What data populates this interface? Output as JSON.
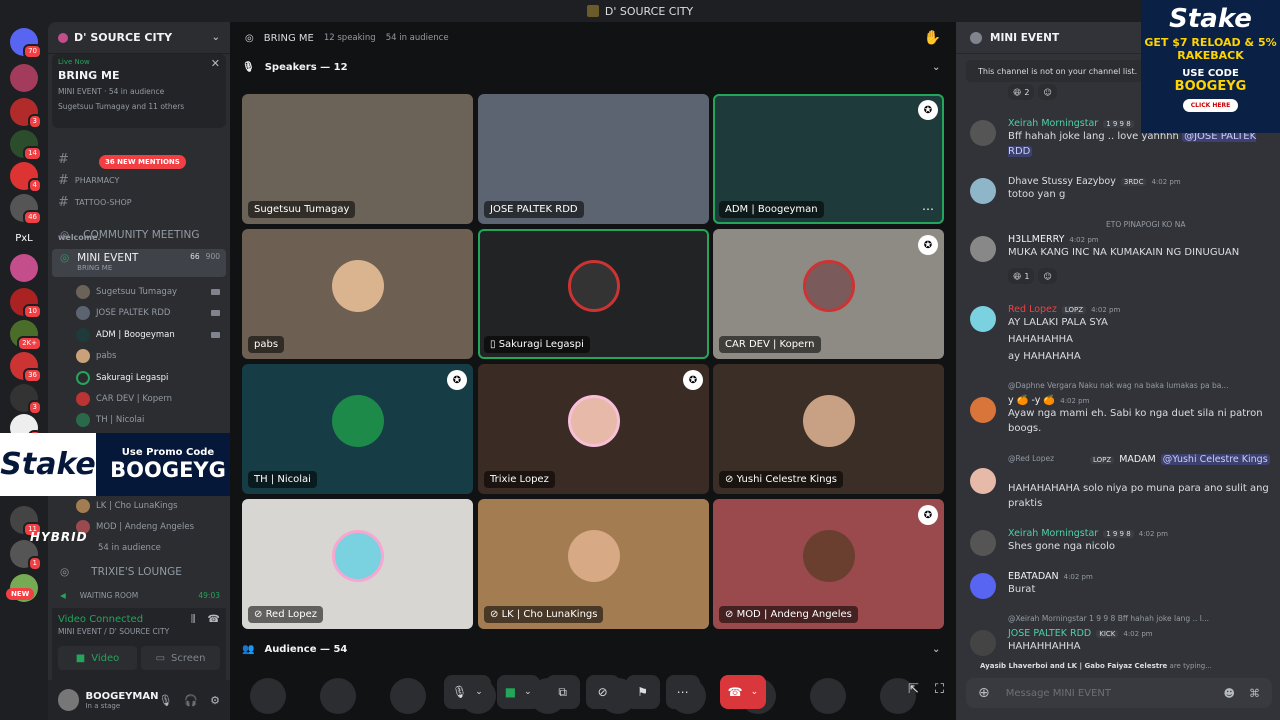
{
  "window": {
    "title": "D' SOURCE CITY"
  },
  "rail": {
    "badges": [
      "70",
      "3",
      "14",
      "4",
      "46",
      "PxL",
      "10",
      "2K+",
      "36",
      "3",
      "3",
      "11",
      "1",
      "NEW"
    ]
  },
  "sidebar": {
    "server_name": "D' SOURCE CITY",
    "live": {
      "tag": "Live Now",
      "title": "BRING ME",
      "sub1": "MINI EVENT · 54 in audience",
      "sub2": "Sugetsuu Tumagay and 11 others"
    },
    "mentions": "36 NEW MENTIONS",
    "text_channels": [
      "PHARMACY",
      "TATTOO-SHOP"
    ],
    "welcome": "welcome.",
    "community": "COMMUNITY MEETING",
    "mini_event": {
      "name": "MINI EVENT",
      "sub": "BRING ME",
      "count": "66",
      "cap": "900"
    },
    "users": [
      "Sugetsuu Tumagay",
      "JOSE PALTEK RDD",
      "ADM | Boogeyman",
      "pabs",
      "Sakuragi Legaspi",
      "CAR DEV | Kopern",
      "TH | Nicolai",
      "LK | Cho LunaKings",
      "MOD | Andeng Angeles"
    ],
    "audience": "54 in audience",
    "trixie": "TRIXIE'S LOUNGE",
    "waiting": "WAITING ROOM",
    "waiting_time": "49:03",
    "voice": {
      "status": "Video Connected",
      "where": "MINI EVENT / D' SOURCE CITY",
      "video": "Video",
      "screen": "Screen"
    },
    "me": {
      "name": "BOOGEYMAN",
      "status": "In a stage"
    }
  },
  "ads": {
    "left_logo": "Stake",
    "left_line1": "Use Promo Code",
    "left_code": "BOOGEYG",
    "hybrid": "HYBRID",
    "right_logo": "Stake",
    "right_offer": "GET $7 RELOAD & 5% RAKEBACK",
    "right_use": "USE CODE",
    "right_code": "BOOGEYG",
    "right_btn": "CLICK HERE"
  },
  "stage": {
    "title": "BRING ME",
    "speaking": "12 speaking",
    "audience": "54 in audience",
    "speakers_label": "Speakers — 12",
    "audience_label": "Audience — 54",
    "tiles": [
      {
        "name": "Sugetsuu Tumagay",
        "bg": "#6b6258"
      },
      {
        "name": "JOSE PALTEK RDD",
        "bg": "#5b6470"
      },
      {
        "name": "ADM | Boogeyman",
        "bg": "#1f3a3a"
      },
      {
        "name": "pabs",
        "bg": "#6e5f53"
      },
      {
        "name": "Sakuragi Legaspi",
        "bg": "#222325"
      },
      {
        "name": "CAR DEV | Kopern",
        "bg": "#8e8a84"
      },
      {
        "name": "TH | Nicolai",
        "bg": "#163c46"
      },
      {
        "name": "Trixie Lopez",
        "bg": "#3a2b24"
      },
      {
        "name": "Yushi Celestre Kings",
        "bg": "#3b2e27"
      },
      {
        "name": "Red Lopez",
        "bg": "#d8d6d2"
      },
      {
        "name": "LK | Cho LunaKings",
        "bg": "#a37c52"
      },
      {
        "name": "MOD | Andeng Angeles",
        "bg": "#9a4a4c"
      }
    ]
  },
  "chat": {
    "channel": "MINI EVENT",
    "notice": "This channel is not on your channel list.",
    "placeholder": "Message MINI EVENT",
    "react1": "2",
    "react2": "1",
    "messages": [
      {
        "user": "Xeirah Morningstar",
        "tag": "1 9 9 8",
        "color": "#4fd1a5",
        "time": "",
        "text": "Bff hahah joke lang .. love yahhhh",
        "mention": "@JOSE PALTEK RDD"
      },
      {
        "user": "Dhave Stussy Eazyboy",
        "tag": "3RDC",
        "color": "#dbdee1",
        "time": "4:02 pm",
        "text": "totoo yan g",
        "mention": ""
      },
      {
        "user": "H3LLMERRY",
        "tag": "",
        "color": "#f2f3f5",
        "time": "4:02 pm",
        "text": "MUKA KANG INC NA KUMAKAIN NG DINUGUAN",
        "mention": ""
      },
      {
        "user": "Red Lopez",
        "tag": "LOPZ",
        "color": "#f23f43",
        "time": "4:02 pm",
        "text": "AY LALAKI PALA SYA",
        "mention": ""
      },
      {
        "user": "",
        "tag": "",
        "color": "",
        "time": "",
        "text": "HAHAHAHHA",
        "mention": ""
      },
      {
        "user": "",
        "tag": "",
        "color": "",
        "time": "",
        "text": "ay HAHAHAHA",
        "mention": ""
      },
      {
        "user": "y 🍊 -y 🍊",
        "tag": "",
        "color": "#f2f3f5",
        "time": "4:02 pm",
        "text": "Ayaw nga mami eh. Sabi ko nga duet sila ni patron boogs.",
        "mention": ""
      },
      {
        "user": "MADAM",
        "tag": "LOPZ",
        "color": "#f2f3f5",
        "time": "",
        "text": "HAHAHAHAHA solo niya po muna para ano sulit ang praktis",
        "mention": "@Yushi Celestre Kings"
      },
      {
        "user": "Xeirah Morningstar",
        "tag": "1 9 9 8",
        "color": "#4fd1a5",
        "time": "4:02 pm",
        "text": "Shes gone nga nicolo",
        "mention": ""
      },
      {
        "user": "EBATADAN",
        "tag": "",
        "color": "#f2f3f5",
        "time": "4:02 pm",
        "text": "Burat",
        "mention": ""
      },
      {
        "user": "JOSE PALTEK RDD",
        "tag": "KICK",
        "color": "#4fd1a5",
        "time": "4:02 pm",
        "text": "HAHAHHAHHA",
        "mention": ""
      }
    ],
    "replies": [
      "ETO PINAPOGI KO NA",
      "@Daphne Vergara  Naku nak wag na baka lumakas pa ba...",
      "@Red Lopez",
      "@Xeirah Morningstar  1 9 9 8  Bff hahah joke lang .. l..."
    ],
    "typing_users": "Ayasib Lhaverboi and LK | Gabo Faiyaz Celestre",
    "typing_suffix": "are typing..."
  },
  "colors": {
    "accent": "#5865f2",
    "green": "#23a55a",
    "red": "#da373c"
  }
}
